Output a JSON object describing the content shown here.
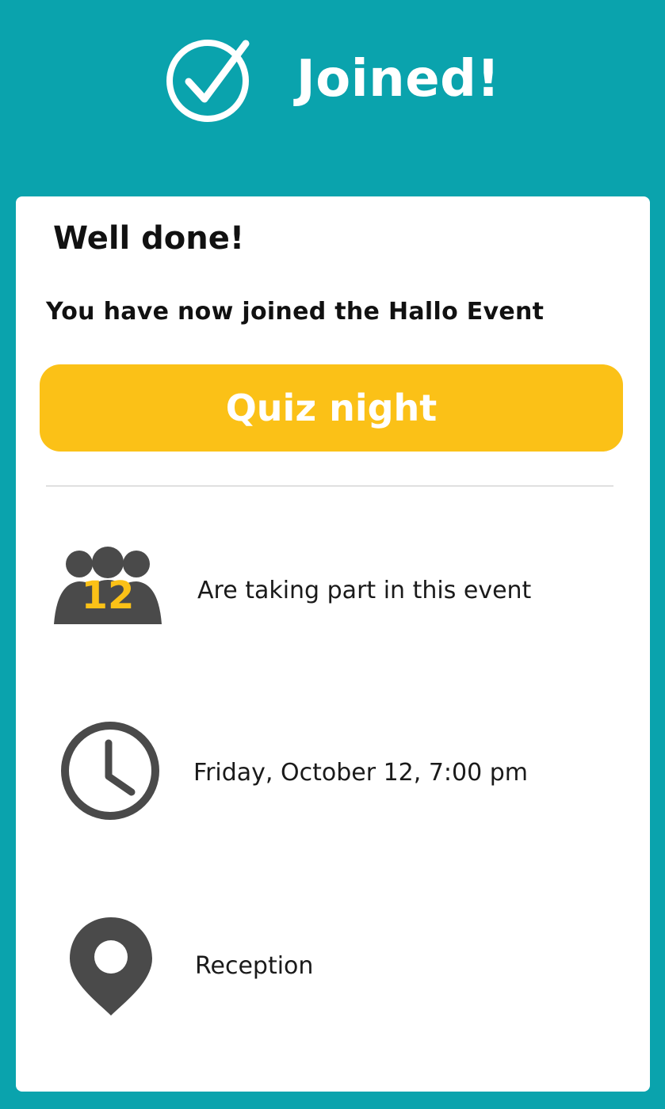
{
  "header": {
    "title": "Joined!",
    "icon": "check-circle-icon",
    "background_color": "#0aa3ad"
  },
  "card": {
    "greeting": "Well done!",
    "subtitle": "You have now joined the Hallo Event",
    "event_button": {
      "label": "Quiz night",
      "color": "#fbc117"
    },
    "details": {
      "participants": {
        "icon": "people-group-icon",
        "count": "12",
        "text": "Are taking part in this event"
      },
      "time": {
        "icon": "clock-icon",
        "text": "Friday, October 12, 7:00 pm"
      },
      "location": {
        "icon": "location-pin-icon",
        "text": "Reception"
      }
    }
  },
  "colors": {
    "icon_gray": "#4a4a4a",
    "badge_yellow": "#fbc117"
  }
}
